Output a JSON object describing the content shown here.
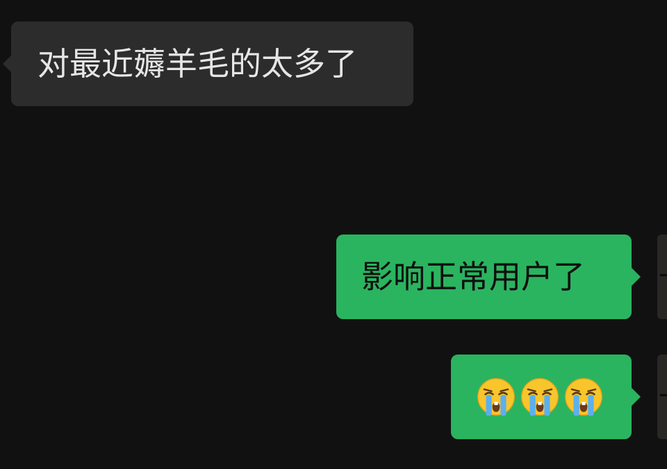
{
  "messages": [
    {
      "side": "incoming",
      "text": "对最近薅羊毛的太多了"
    },
    {
      "side": "outgoing",
      "text": "影响正常用户了"
    },
    {
      "side": "outgoing",
      "emojis": [
        "loudly-crying-face-emoji",
        "loudly-crying-face-emoji",
        "loudly-crying-face-emoji"
      ]
    }
  ],
  "colors": {
    "background": "#111111",
    "incoming_bubble": "#2c2c2c",
    "outgoing_bubble": "#2ab45f"
  }
}
